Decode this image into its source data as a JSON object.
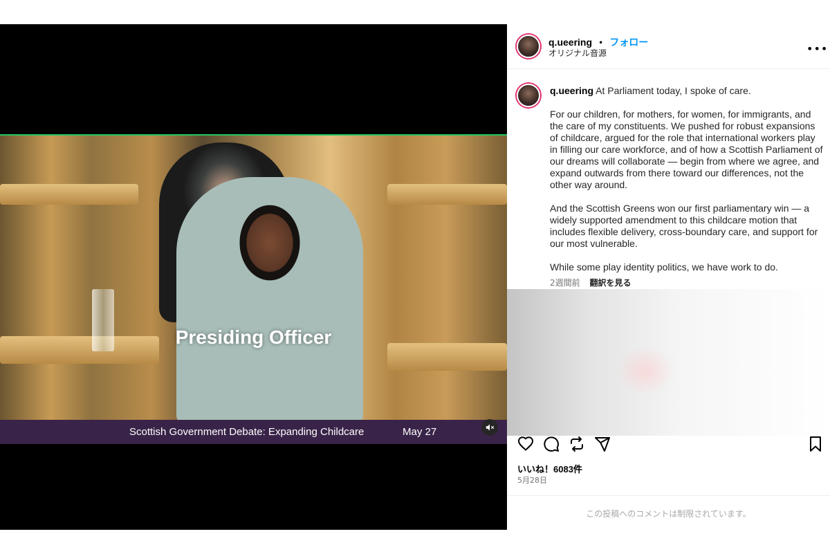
{
  "video": {
    "overlay_title": "Presiding Officer",
    "banner_text": "Scottish Government Debate: Expanding Childcare",
    "banner_date": "May 27",
    "mute_icon": "muted-speaker-icon"
  },
  "header": {
    "username": "q.ueering",
    "separator": "•",
    "follow_label": "フォロー",
    "audio_label": "オリジナル音源",
    "more_icon": "more-options-icon"
  },
  "post": {
    "username": "q.ueering",
    "caption_first": "At Parliament today, I spoke of care.",
    "paragraphs": [
      "For our children, for mothers, for women, for immigrants, and the care of my constituents. We pushed for robust expansions of childcare, argued for the role that international workers play in filling our care workforce, and of how a Scottish Parliament of our dreams will collaborate — begin from where we agree, and expand outwards from there toward our differences, not the other way around.",
      "And the Scottish Greens won our first parliamentary win — a widely supported amendment to this childcare motion that includes flexible delivery, cross-boundary care, and support for our most vulnerable.",
      "While some play identity politics, we have work to do."
    ],
    "time_ago": "2週間前",
    "translate_label": "翻訳を見る"
  },
  "actions": {
    "like_icon": "heart-icon",
    "comment_icon": "comment-icon",
    "repost_icon": "repost-icon",
    "share_icon": "share-icon",
    "save_icon": "bookmark-icon"
  },
  "stats": {
    "likes_text": "いいね！6083件",
    "date_text": "5月28日"
  },
  "comments": {
    "restricted_text": "この投稿へのコメントは制限されています。"
  }
}
